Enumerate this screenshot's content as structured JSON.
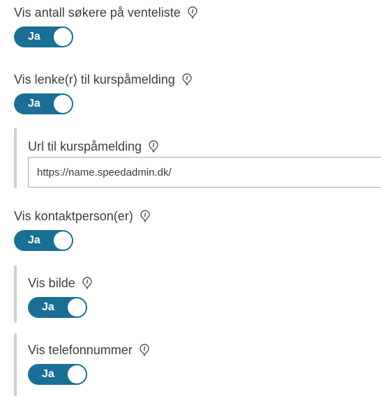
{
  "settings": [
    {
      "label": "Vis antall søkere på venteliste",
      "toggle": "Ja"
    },
    {
      "label": "Vis lenke(r) til kurspåmelding",
      "toggle": "Ja"
    },
    {
      "label": "Url til kurspåmelding",
      "value": "https://name.speedadmin.dk/"
    },
    {
      "label": "Vis kontaktperson(er)",
      "toggle": "Ja"
    },
    {
      "label": "Vis bilde",
      "toggle": "Ja"
    },
    {
      "label": "Vis telefonnummer",
      "toggle": "Ja"
    }
  ],
  "colors": {
    "toggle_on": "#1a6f94",
    "text": "#3d3d3d",
    "sub_border": "#cfcfcf"
  },
  "icons": {
    "info": "info-pin-icon"
  }
}
